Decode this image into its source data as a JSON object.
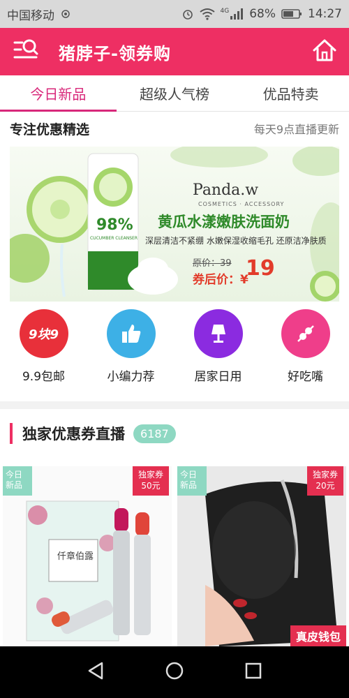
{
  "status_bar": {
    "carrier": "中国移动",
    "network": "4G",
    "battery": "68%",
    "time": "14:27"
  },
  "app_bar": {
    "title": "猪脖子-领券购",
    "menu_icon": "menu-search-icon",
    "home_icon": "home-icon"
  },
  "tabs": [
    {
      "label": "今日新品",
      "active": true
    },
    {
      "label": "超级人气榜",
      "active": false
    },
    {
      "label": "优品特卖",
      "active": false
    }
  ],
  "picks": {
    "title": "专注优惠精选",
    "subtitle": "每天9点直播更新"
  },
  "banner": {
    "brand": "Panda.w",
    "brand_sub": "COSMETICS · ACCESSORY",
    "headline": "黄瓜水漾嫩肤洗面奶",
    "desc": "深层清洁不紧绷 水嫩保湿收缩毛孔 还原洁净肤质",
    "original_price": "原价：39",
    "price_label": "券后价：¥",
    "price": "19",
    "tube_text": "98%",
    "tube_sub": "CUCUMBER CLEANSER"
  },
  "categories": [
    {
      "label": "9.9包邮",
      "icon": "9块9",
      "color": "#e8303a"
    },
    {
      "label": "小编力荐",
      "icon": "thumbs-up-icon",
      "color": "#3db0e6"
    },
    {
      "label": "居家日用",
      "icon": "lamp-icon",
      "color": "#8b2be0"
    },
    {
      "label": "好吃嘴",
      "icon": "skewer-icon",
      "color": "#ef3e8a"
    }
  ],
  "coupon_section": {
    "title": "独家优惠券直播",
    "count": "6187"
  },
  "products": [
    {
      "badge_new": "今日新品",
      "coupon_type": "独家券",
      "coupon_value": "50元",
      "box_text": "仟章伯露"
    },
    {
      "badge_new": "今日新品",
      "coupon_type": "独家券",
      "coupon_value": "20元",
      "tag": "真皮钱包"
    }
  ],
  "colors": {
    "accent": "#ee2f63",
    "tab_active": "#d8287a",
    "badge_new": "#8ed8c2",
    "badge_coupon": "#e42f50"
  }
}
